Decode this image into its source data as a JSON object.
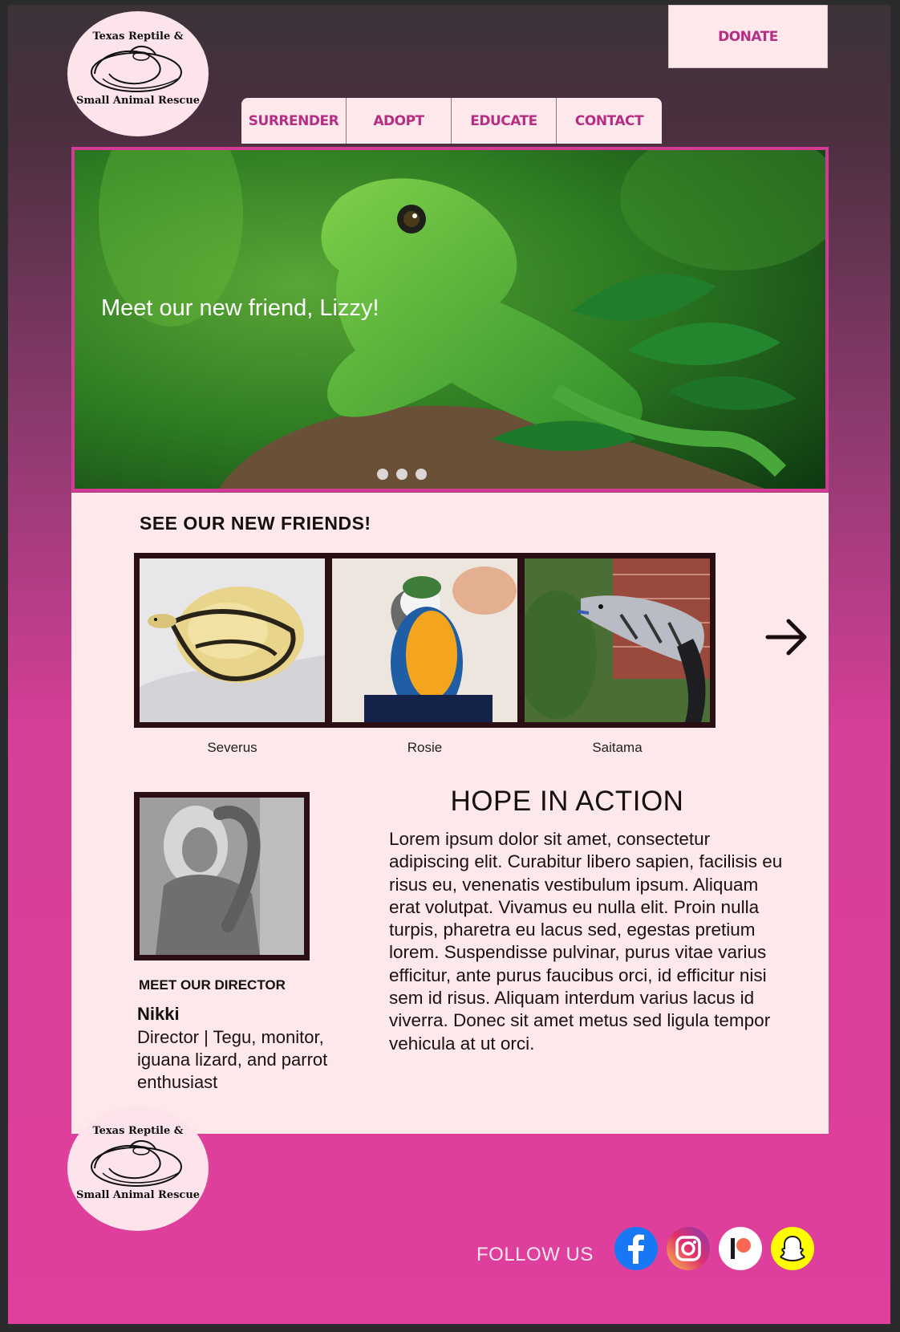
{
  "header": {
    "logo_top": "Texas Reptile &",
    "logo_bottom": "Small Animal Rescue",
    "donate_label": "DONATE"
  },
  "nav": {
    "tabs": [
      {
        "label": "SURRENDER"
      },
      {
        "label": "ADOPT"
      },
      {
        "label": "EDUCATE"
      },
      {
        "label": "CONTACT"
      }
    ]
  },
  "hero": {
    "caption": "Meet our new friend, Lizzy!",
    "slide_count": 3
  },
  "friends": {
    "title": "SEE OUR NEW FRIENDS!",
    "items": [
      {
        "name": "Severus"
      },
      {
        "name": "Rosie"
      },
      {
        "name": "Saitama"
      }
    ],
    "next_icon": "arrow-right-icon"
  },
  "director": {
    "label": "MEET OUR DIRECTOR",
    "name": "Nikki",
    "role": "Director | Tegu, monitor, iguana lizard, and parrot enthusiast"
  },
  "hope": {
    "title": "HOPE IN ACTION",
    "body": "Lorem ipsum dolor sit amet, consectetur adipiscing elit. Curabitur libero sapien, facilisis eu risus eu, venenatis vestibulum ipsum. Aliquam erat volutpat. Vivamus eu nulla elit. Proin nulla turpis, pharetra eu lacus sed, egestas pretium lorem. Suspendisse pulvinar, purus vitae varius efficitur, ante purus faucibus orci, id efficitur nisi sem id risus. Aliquam interdum varius lacus id viverra. Donec sit amet metus sed ligula tempor vehicula at ut orci."
  },
  "footer": {
    "logo_top": "Texas Reptile &",
    "logo_bottom": "Small Animal Rescue",
    "follow_label": "FOLLOW US",
    "socials": [
      {
        "icon": "facebook-icon"
      },
      {
        "icon": "instagram-icon"
      },
      {
        "icon": "patreon-icon"
      },
      {
        "icon": "snapchat-icon"
      }
    ]
  },
  "colors": {
    "accent": "#b52e83",
    "frame_pink": "#d33a95",
    "panel_bg": "#fde8ea"
  }
}
